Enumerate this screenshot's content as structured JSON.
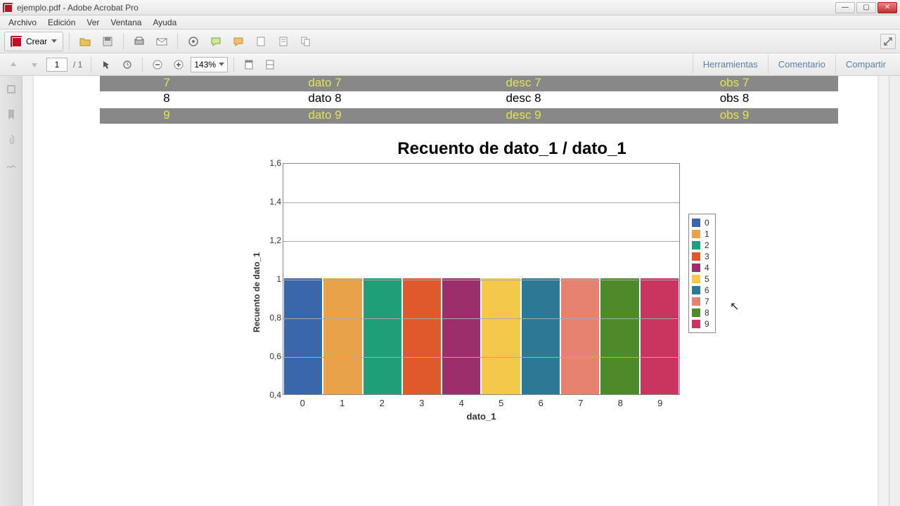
{
  "window": {
    "title": "ejemplo.pdf - Adobe Acrobat Pro"
  },
  "menubar": [
    "Archivo",
    "Edición",
    "Ver",
    "Ventana",
    "Ayuda"
  ],
  "toolbar": {
    "crear_label": "Crear"
  },
  "nav": {
    "page": "1",
    "page_total": "/ 1",
    "zoom": "143%"
  },
  "right_tabs": [
    "Herramientas",
    "Comentario",
    "Compartir"
  ],
  "table": {
    "rows": [
      {
        "n": "7",
        "dato": "dato 7",
        "desc": "desc 7",
        "obs": "obs 7",
        "dark": true
      },
      {
        "n": "8",
        "dato": "dato 8",
        "desc": "desc 8",
        "obs": "obs 8",
        "dark": false
      },
      {
        "n": "9",
        "dato": "dato 9",
        "desc": "desc 9",
        "obs": "obs 9",
        "dark": true
      }
    ]
  },
  "chart_data": {
    "type": "bar",
    "title": "Recuento de dato_1 / dato_1",
    "xlabel": "dato_1",
    "ylabel": "Recuento de dato_1",
    "categories": [
      "0",
      "1",
      "2",
      "3",
      "4",
      "5",
      "6",
      "7",
      "8",
      "9"
    ],
    "values": [
      1,
      1,
      1,
      1,
      1,
      1,
      1,
      1,
      1,
      1
    ],
    "ylim": [
      0.4,
      1.6
    ],
    "yticks": [
      "0,4",
      "0,6",
      "0,8",
      "1",
      "1,2",
      "1,4",
      "1,6"
    ],
    "colors": [
      "#3a67a8",
      "#e8a34a",
      "#1f9e77",
      "#e0592c",
      "#9a2f6b",
      "#f3c84b",
      "#2c7995",
      "#e88270",
      "#4d8a2a",
      "#c9355f"
    ],
    "legend": [
      "0",
      "1",
      "2",
      "3",
      "4",
      "5",
      "6",
      "7",
      "8",
      "9"
    ]
  }
}
